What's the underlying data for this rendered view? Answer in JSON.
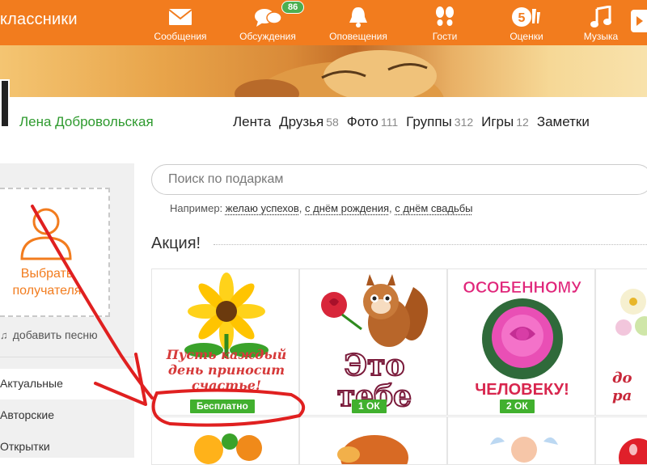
{
  "header": {
    "brand": "классники",
    "nav": [
      {
        "label": "Сообщения",
        "icon": "envelope-icon"
      },
      {
        "label": "Обсуждения",
        "icon": "chat-bubbles-icon",
        "badge": "86"
      },
      {
        "label": "Оповещения",
        "icon": "bell-icon"
      },
      {
        "label": "Гости",
        "icon": "footprints-icon"
      },
      {
        "label": "Оценки",
        "icon": "ratings-icon"
      },
      {
        "label": "Музыка",
        "icon": "music-note-icon"
      }
    ]
  },
  "profile": {
    "name": "Лена Добровольская",
    "tabs": [
      {
        "label": "Лента",
        "count": ""
      },
      {
        "label": "Друзья",
        "count": "58"
      },
      {
        "label": "Фото",
        "count": "111"
      },
      {
        "label": "Группы",
        "count": "312"
      },
      {
        "label": "Игры",
        "count": "12"
      },
      {
        "label": "Заметки",
        "count": ""
      }
    ]
  },
  "sidebar": {
    "recipient_label": "Выбрать получателя",
    "add_song": "добавить песню",
    "items": [
      "Актуальные",
      "Авторские",
      "Открытки"
    ],
    "active_index": 0
  },
  "search": {
    "placeholder": "Поиск по подаркам",
    "examples_prefix": "Например:",
    "examples": [
      "желаю успехов",
      "с днём рождения",
      "с днём свадьбы"
    ]
  },
  "section": {
    "title": "Акция!"
  },
  "gifts": [
    {
      "caption": "Пусть каждый день приносит счастье!",
      "price": "Бесплатно"
    },
    {
      "caption": "Это тебе",
      "price": "1 ОК"
    },
    {
      "caption_top": "ОСОБЕННОМУ",
      "caption_bottom": "ЧЕЛОВЕКУ!",
      "price": "2 ОК"
    },
    {
      "caption": "до ра",
      "price": ""
    }
  ],
  "colors": {
    "brand_orange": "#f27c1e",
    "price_green": "#41b02e",
    "user_green": "#2e9a2e",
    "annotation_red": "#e02020"
  }
}
